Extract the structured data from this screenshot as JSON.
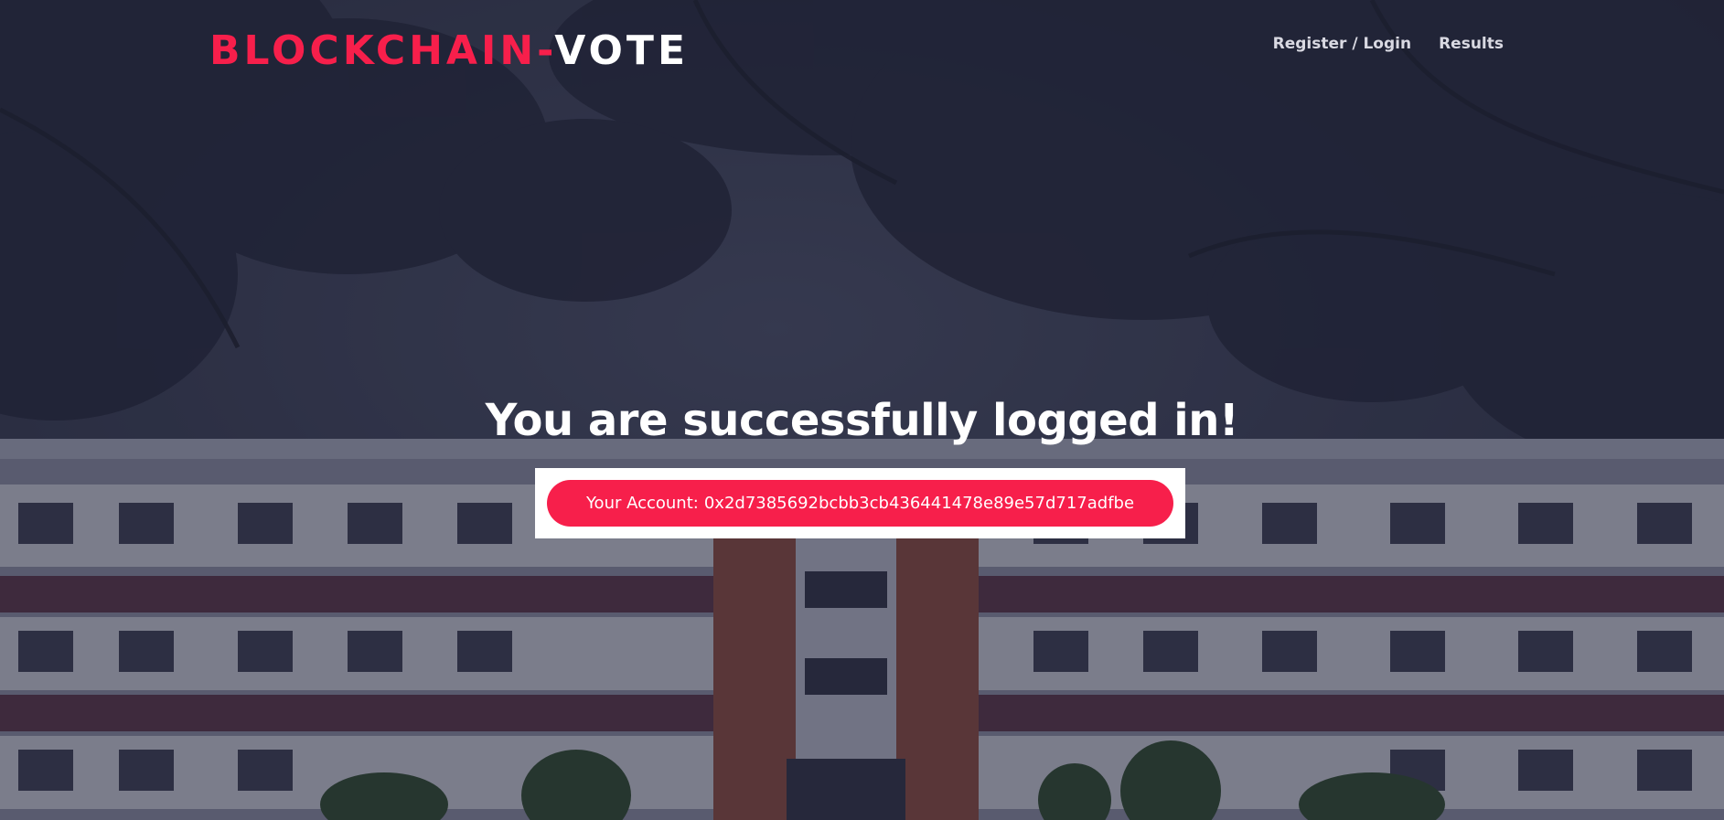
{
  "brand": {
    "part1": "BLOCKCHAIN-",
    "part2": "VOTE"
  },
  "nav": {
    "items": [
      {
        "label": "Register / Login"
      },
      {
        "label": "Results"
      }
    ]
  },
  "main": {
    "headline": "You are successfully logged in!",
    "account_label": "Your Account:",
    "account_address": "0x2d7385692bcbb3cb436441478e89e57d717adfbe"
  },
  "colors": {
    "accent": "#f71f4b",
    "overlay": "#2c2f42"
  }
}
